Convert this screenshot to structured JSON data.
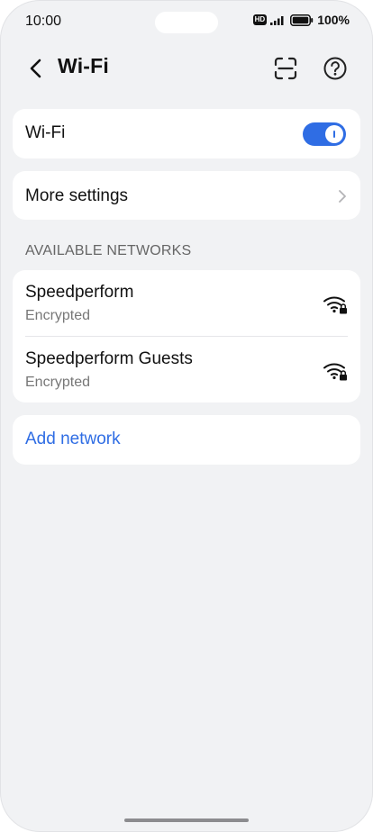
{
  "status_bar": {
    "time": "10:00",
    "hd_badge": "HD",
    "battery_percent": "100%"
  },
  "header": {
    "title": "Wi-Fi",
    "back_icon": "back-chevron-icon",
    "scan_icon": "scan-icon",
    "help_icon": "help-icon"
  },
  "wifi_toggle": {
    "label": "Wi-Fi",
    "enabled": true
  },
  "more_settings": {
    "label": "More settings"
  },
  "available_networks": {
    "heading": "AVAILABLE NETWORKS",
    "items": [
      {
        "name": "Speedperform",
        "security": "Encrypted"
      },
      {
        "name": "Speedperform Guests",
        "security": "Encrypted"
      }
    ]
  },
  "add_network": {
    "label": "Add network"
  },
  "colors": {
    "accent": "#2f6de4",
    "background": "#f1f2f4",
    "card": "#ffffff"
  }
}
